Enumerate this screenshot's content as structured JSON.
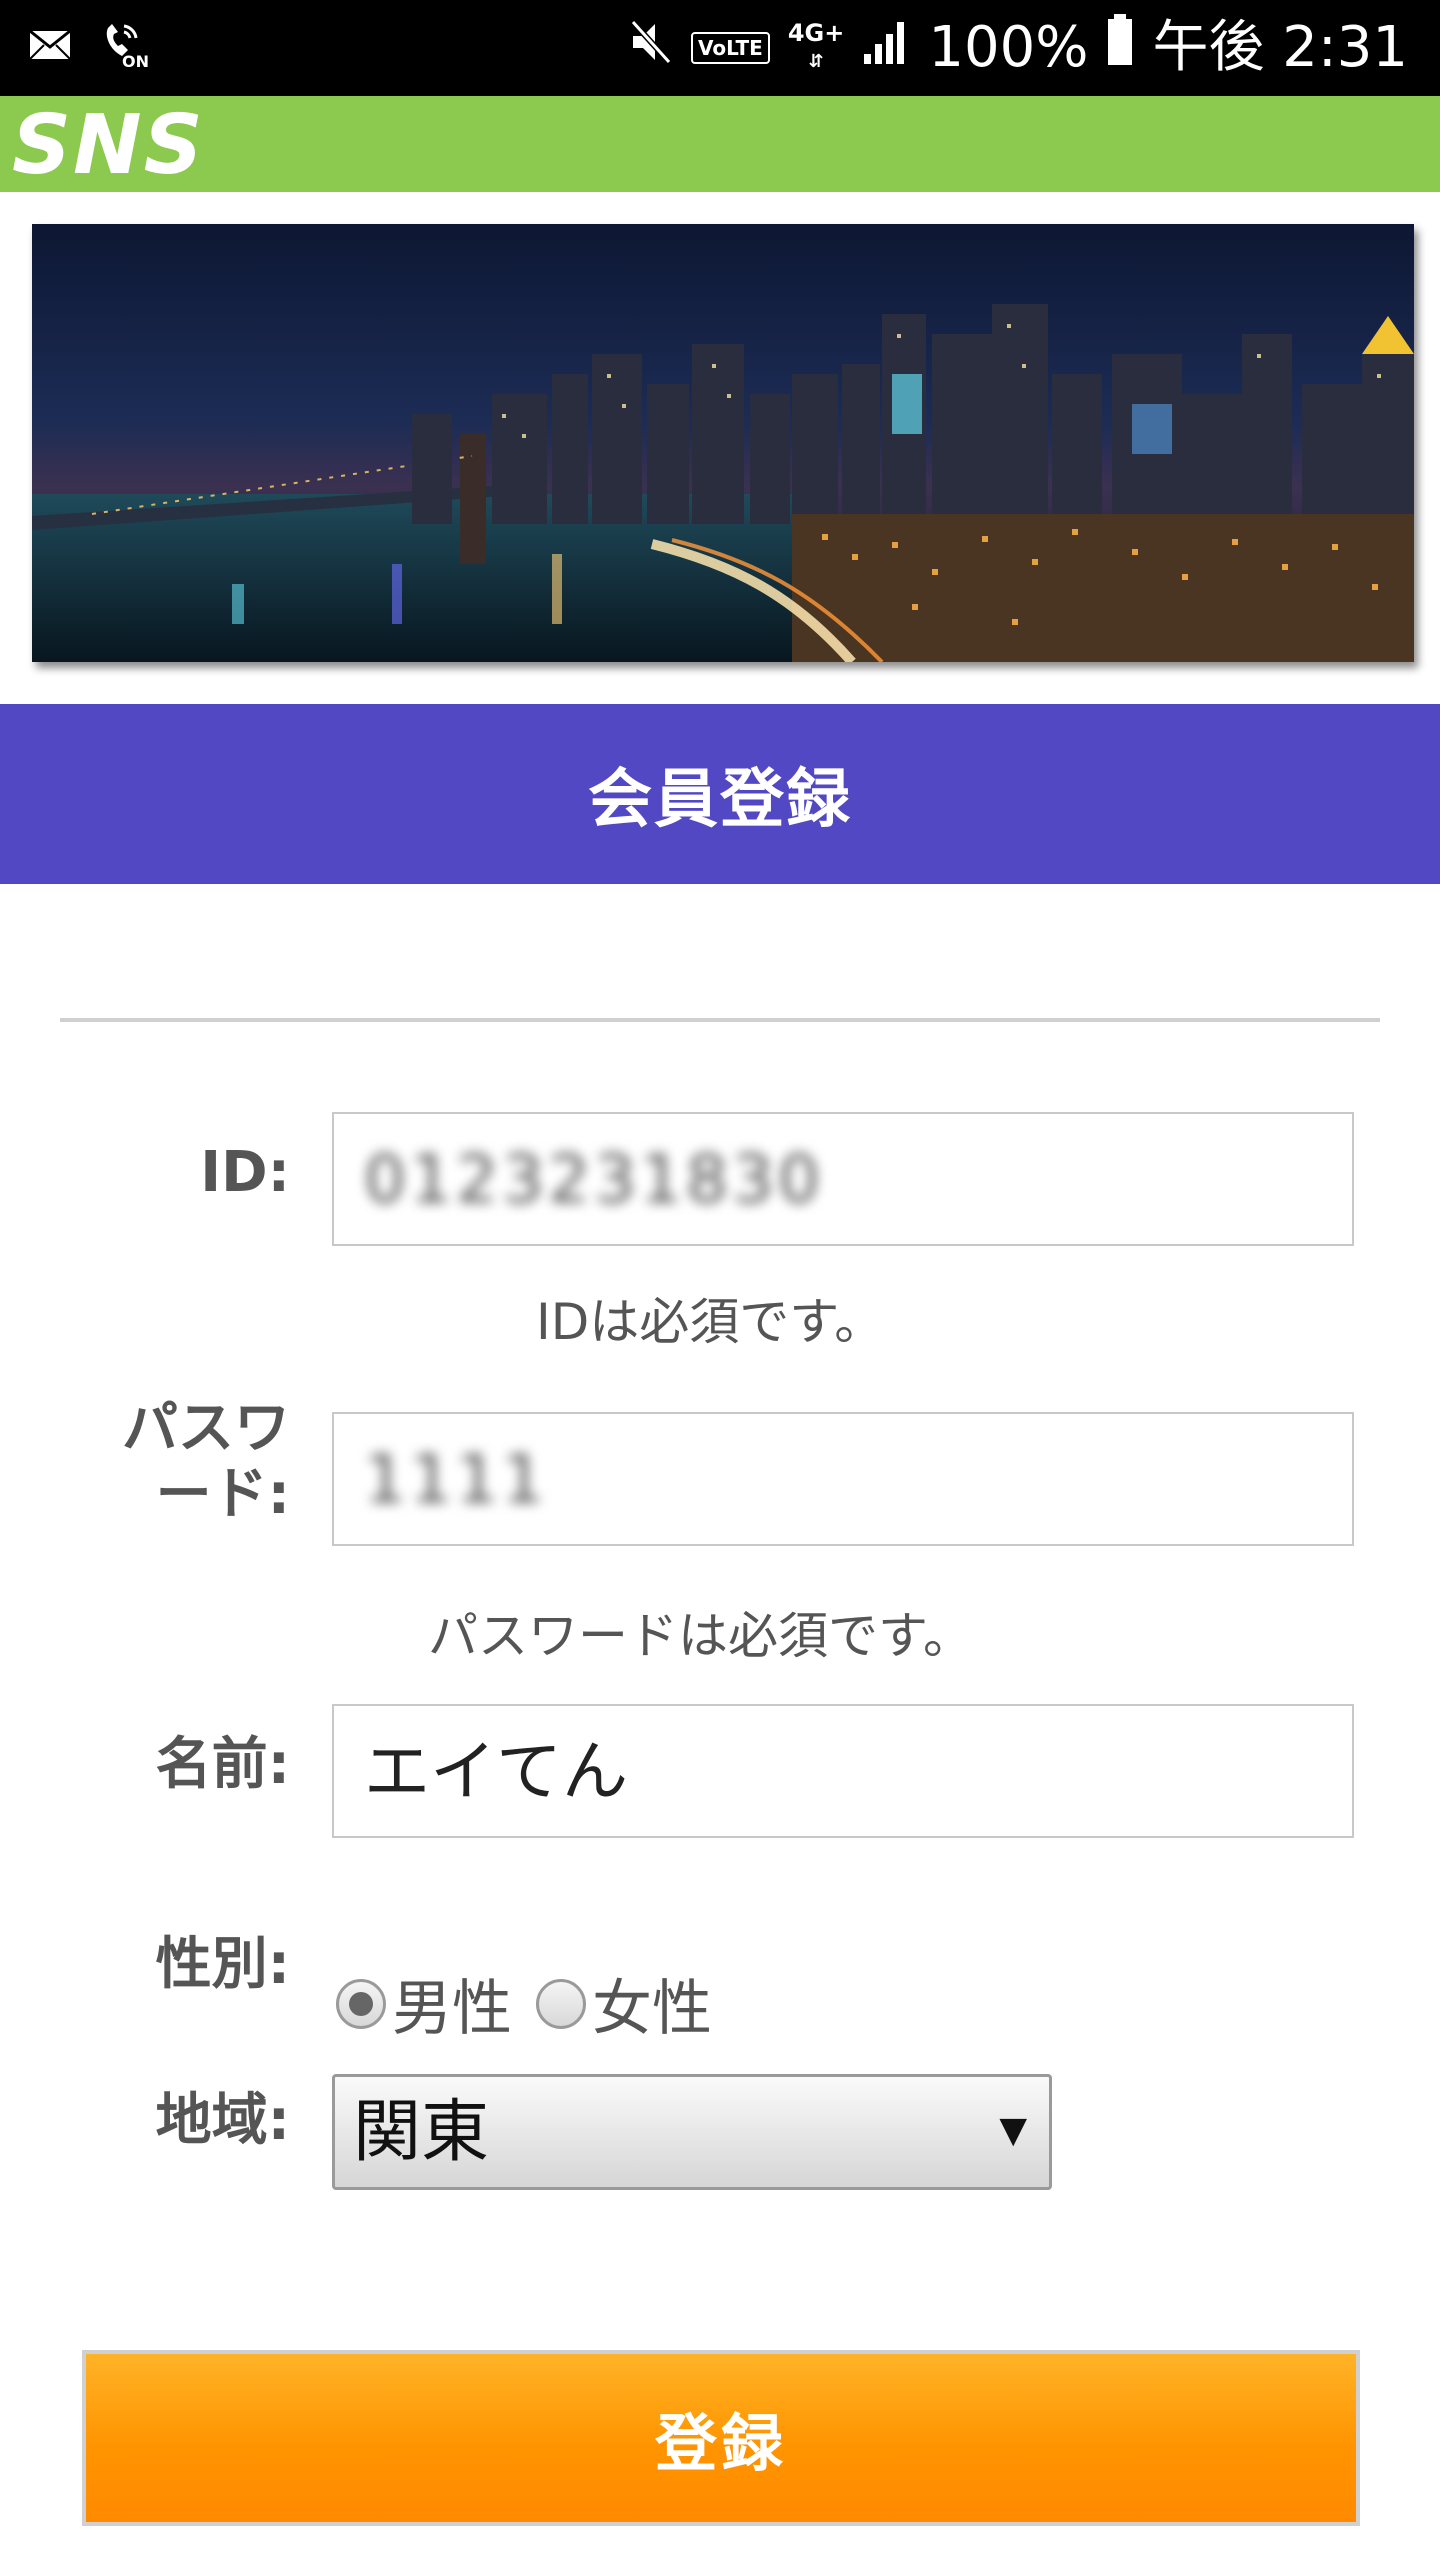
{
  "status_bar": {
    "battery": "100%",
    "time": "午後 2:31",
    "volte": "VoLTE",
    "network": "4G+",
    "call_badge": "ON"
  },
  "app": {
    "logo": "SNS"
  },
  "page_title": "会員登録",
  "form": {
    "id_label": "ID:",
    "id_value": "0123231830",
    "id_message": "IDは必須です。",
    "password_label_line1": "パスワ",
    "password_label_line2": "ード:",
    "password_value": "1111",
    "password_message": "パスワードは必須です。",
    "name_label": "名前:",
    "name_value": "エイてん",
    "gender_label": "性別:",
    "gender_options": [
      "男性",
      "女性"
    ],
    "gender_selected": "男性",
    "region_label": "地域:",
    "region_value": "関東",
    "submit_label": "登録"
  },
  "colors": {
    "status_bar": "#000000",
    "app_bar": "#8cc94f",
    "title_band": "#5248c4",
    "submit": "#ff9400"
  }
}
